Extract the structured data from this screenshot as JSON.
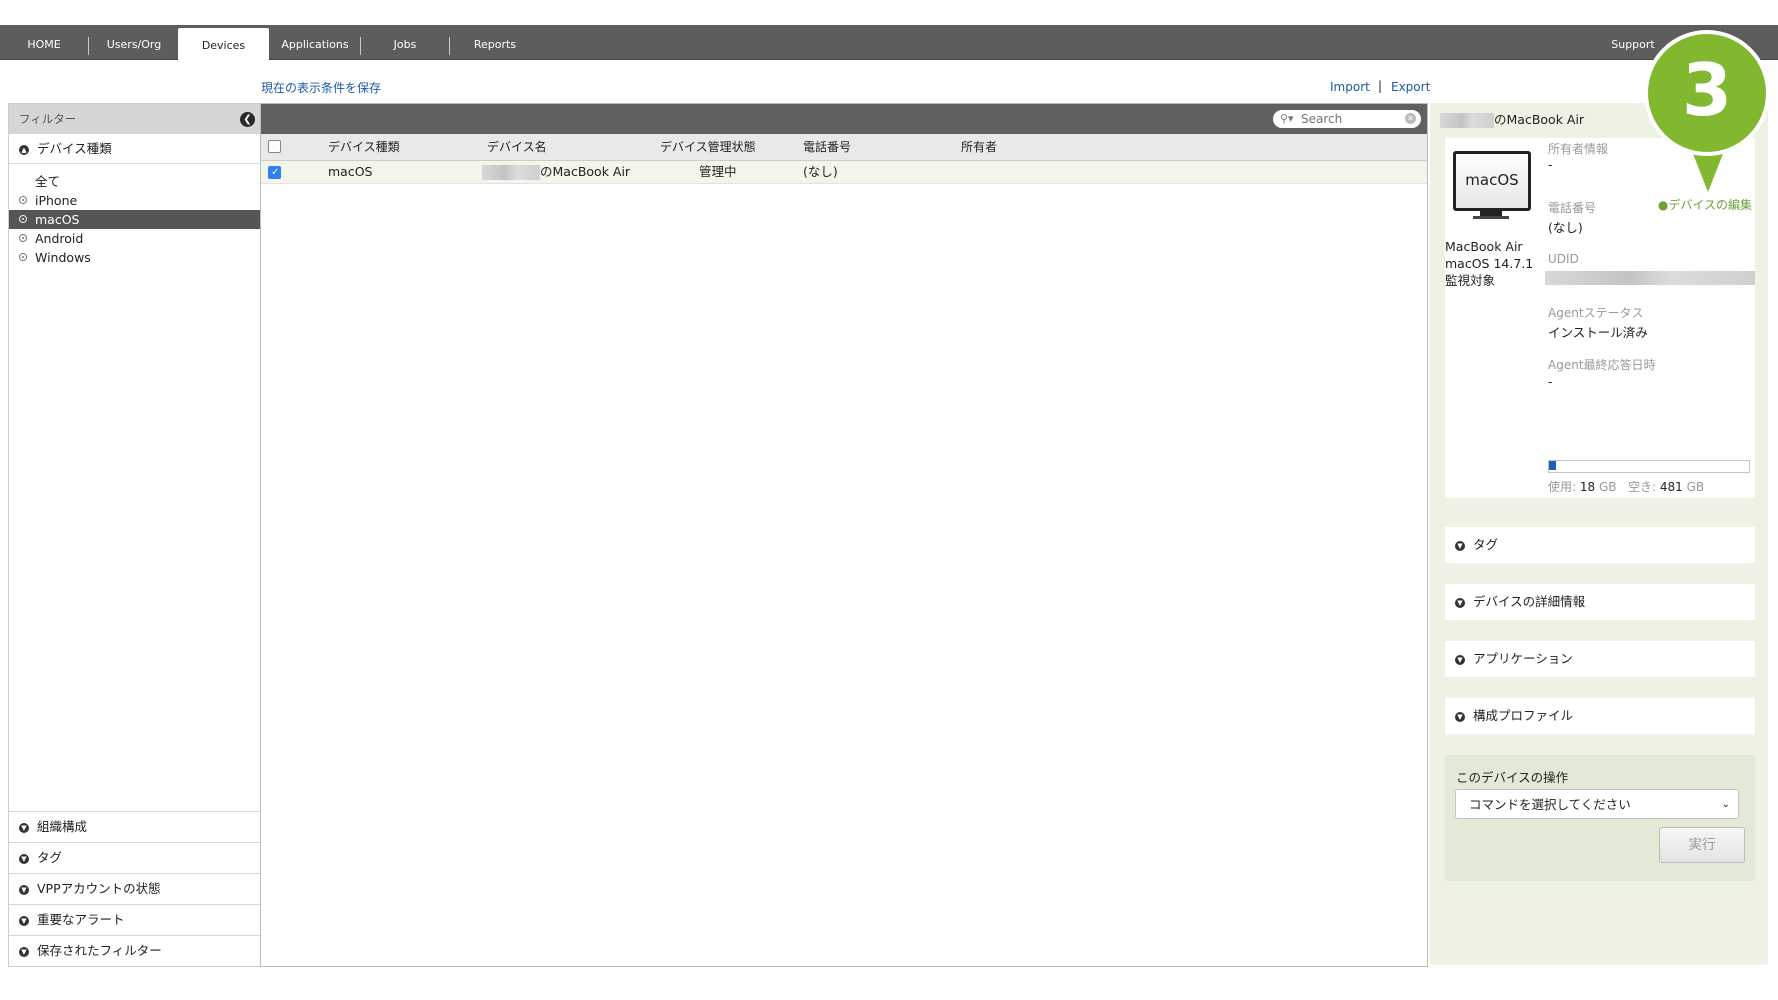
{
  "nav": {
    "tabs": [
      "HOME",
      "Users/Org",
      "Devices",
      "Applications",
      "Jobs",
      "Reports"
    ],
    "active_tab": "Devices",
    "support": "Support"
  },
  "toolbar": {
    "save_view": "現在の表示条件を保存",
    "import": "Import",
    "separator": "|",
    "export": "Export"
  },
  "filter": {
    "title": "フィルター",
    "device_type_section": "デバイス種類",
    "items": [
      "全て",
      "iPhone",
      "macOS",
      "Android",
      "Windows"
    ],
    "selected": "macOS",
    "bottom_sections": [
      "組織構成",
      "タグ",
      "VPPアカウントの状態",
      "重要なアラート",
      "保存されたフィルター"
    ]
  },
  "search": {
    "placeholder": "Search"
  },
  "grid": {
    "columns": [
      "デバイス種類",
      "デバイス名",
      "デバイス管理状態",
      "電話番号",
      "所有者"
    ],
    "rows": [
      {
        "checked": true,
        "device_type": "macOS",
        "device_name": "のMacBook Air",
        "status": "管理中",
        "phone": "(なし)",
        "owner": ""
      }
    ]
  },
  "details": {
    "title": "のMacBook Air",
    "icon_label": "macOS",
    "model": "MacBook Air",
    "os": "macOS 14.7.1",
    "supervised": "監視対象",
    "owner_label": "所有者情報",
    "owner_value": "-",
    "edit_link": "デバイスの編集",
    "phone_label": "電話番号",
    "phone_value": "(なし)",
    "udid_label": "UDID",
    "agent_status_label": "Agentステータス",
    "agent_status_value": "インストール済み",
    "agent_last_label": "Agent最終応答日時",
    "agent_last_value": "-",
    "storage": {
      "used_label": "使用:",
      "used": "18",
      "free_label": "空き:",
      "free": "481",
      "unit": "GB",
      "used_fraction": 0.036
    },
    "accordions": [
      "タグ",
      "デバイスの詳細情報",
      "アプリケーション",
      "構成プロファイル"
    ],
    "operations_title": "このデバイスの操作",
    "command_placeholder": "コマンドを選択してください",
    "run_button": "実行"
  },
  "callout": {
    "number": "3",
    "color": "#81b82f"
  }
}
